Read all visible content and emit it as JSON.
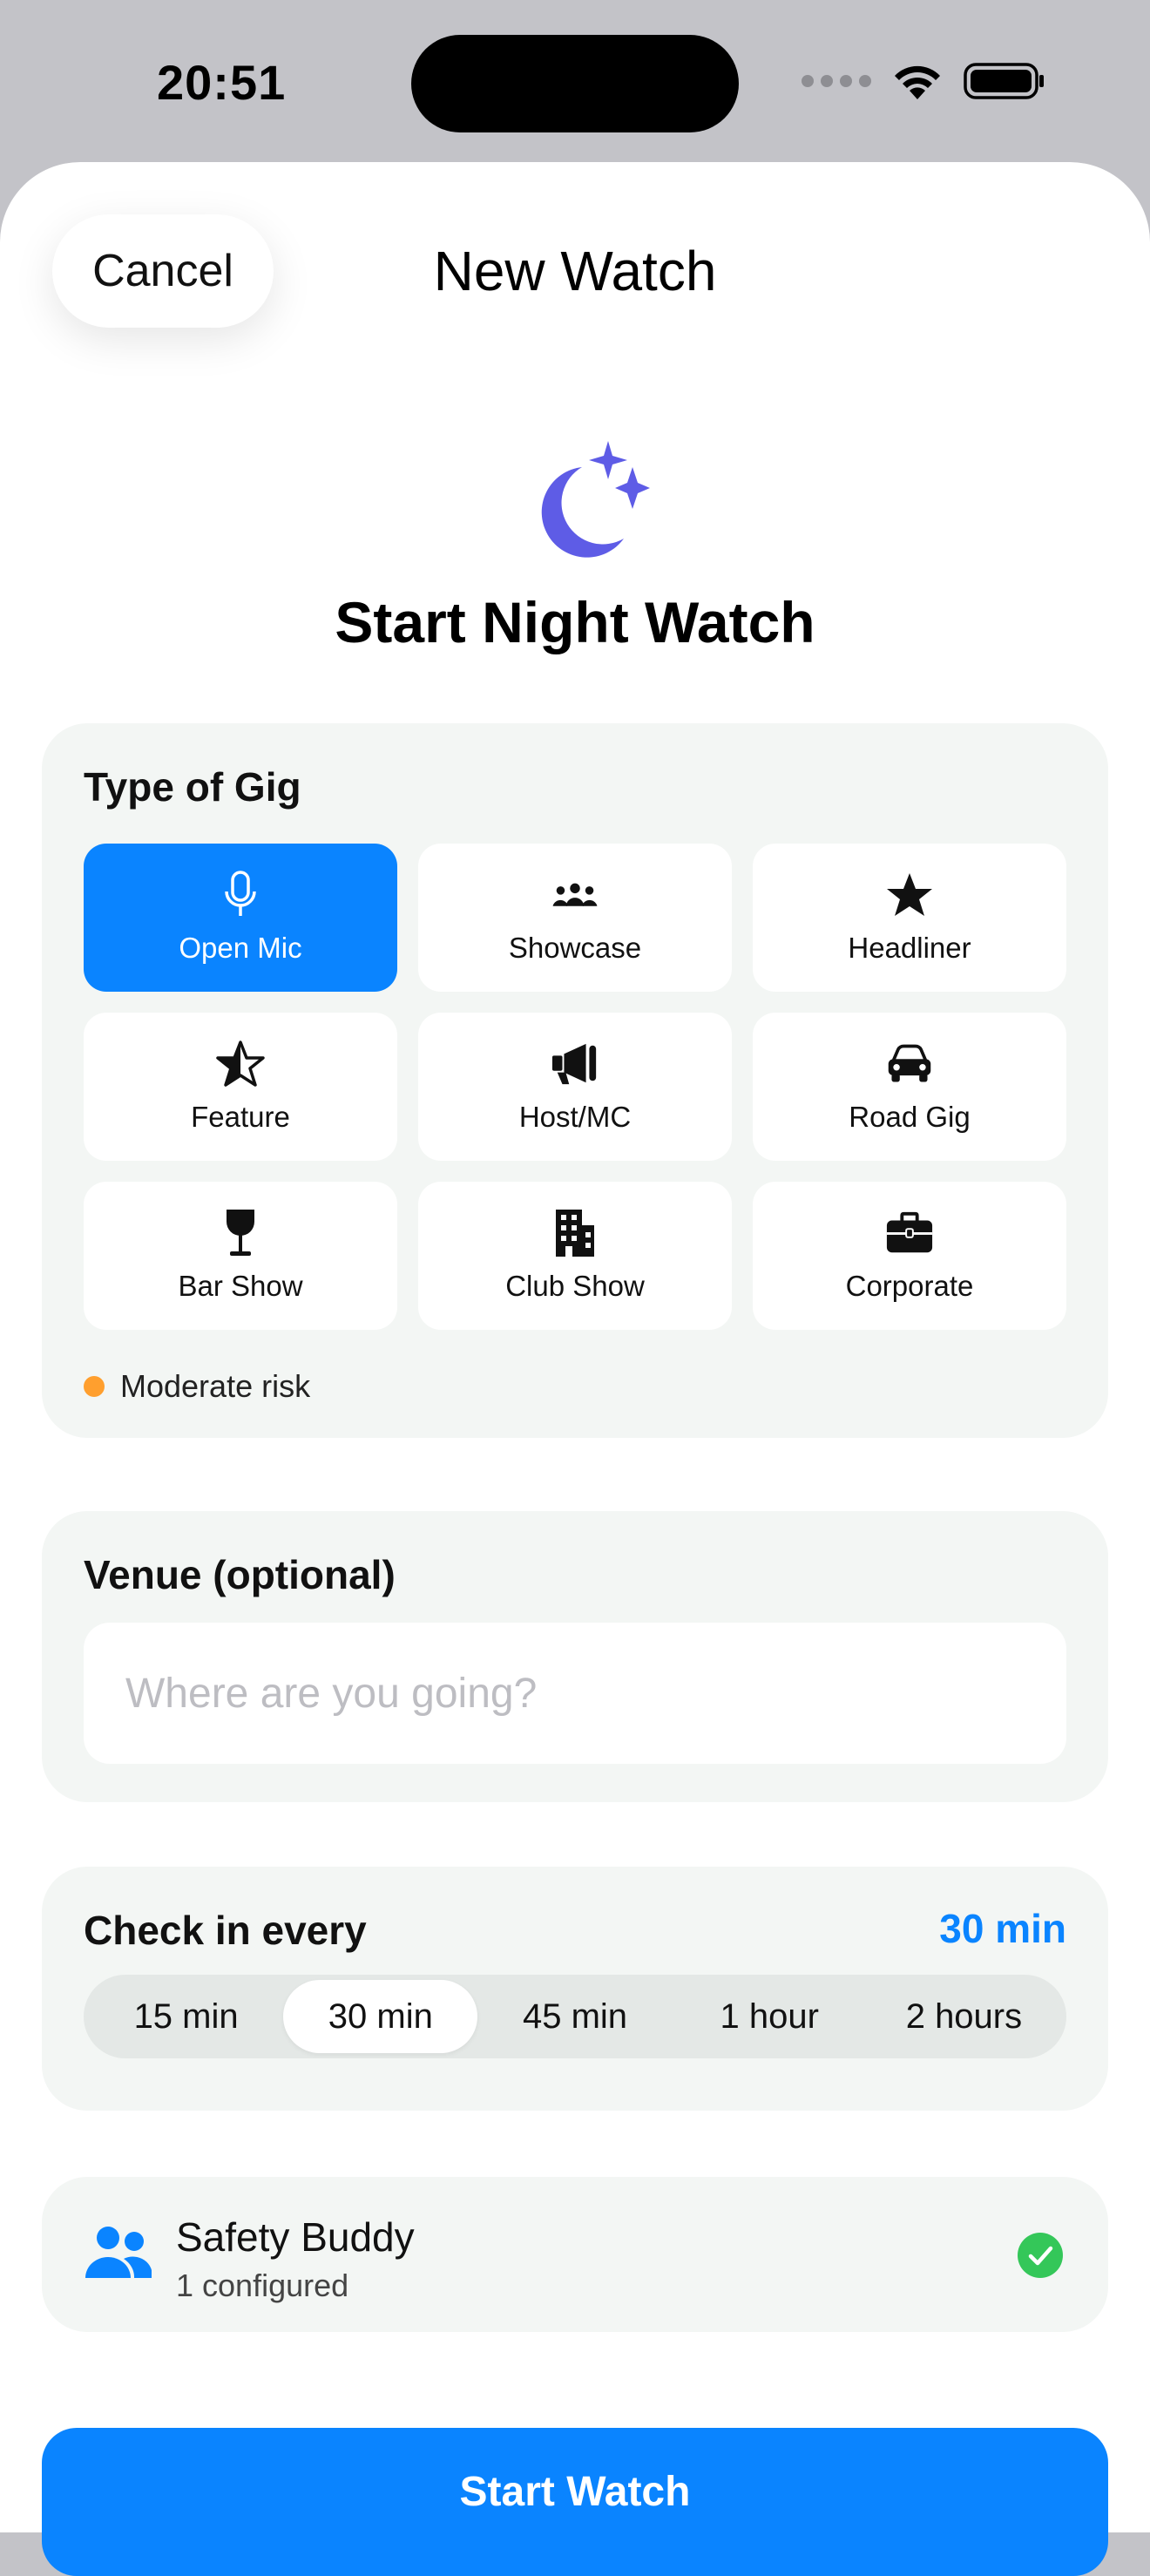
{
  "status_bar": {
    "time": "20:51"
  },
  "nav": {
    "cancel_label": "Cancel",
    "title": "New Watch"
  },
  "hero": {
    "icon": "moon-stars-icon",
    "title": "Start Night Watch"
  },
  "gig": {
    "title": "Type of Gig",
    "options": [
      {
        "label": "Open Mic",
        "icon": "microphone-icon",
        "selected": true
      },
      {
        "label": "Showcase",
        "icon": "people-group-icon",
        "selected": false
      },
      {
        "label": "Headliner",
        "icon": "star-icon",
        "selected": false
      },
      {
        "label": "Feature",
        "icon": "star-half-icon",
        "selected": false
      },
      {
        "label": "Host/MC",
        "icon": "megaphone-icon",
        "selected": false
      },
      {
        "label": "Road Gig",
        "icon": "car-icon",
        "selected": false
      },
      {
        "label": "Bar Show",
        "icon": "wine-glass-icon",
        "selected": false
      },
      {
        "label": "Club Show",
        "icon": "building-icon",
        "selected": false
      },
      {
        "label": "Corporate",
        "icon": "briefcase-icon",
        "selected": false
      }
    ],
    "risk_label": "Moderate risk",
    "risk_color": "#ff9f2e"
  },
  "venue": {
    "title": "Venue (optional)",
    "placeholder": "Where are you going?",
    "value": ""
  },
  "checkin": {
    "title": "Check in every",
    "selected_value": "30 min",
    "options": [
      "15 min",
      "30 min",
      "45 min",
      "1 hour",
      "2 hours"
    ]
  },
  "buddy": {
    "title": "Safety Buddy",
    "subtitle": "1 configured",
    "status": "check-circle-icon"
  },
  "start_button": {
    "label": "Start Watch"
  },
  "colors": {
    "accent": "#0a84ff",
    "hero_icon": "#5e5ce6",
    "success": "#34c759",
    "warning": "#ff9f2e"
  }
}
